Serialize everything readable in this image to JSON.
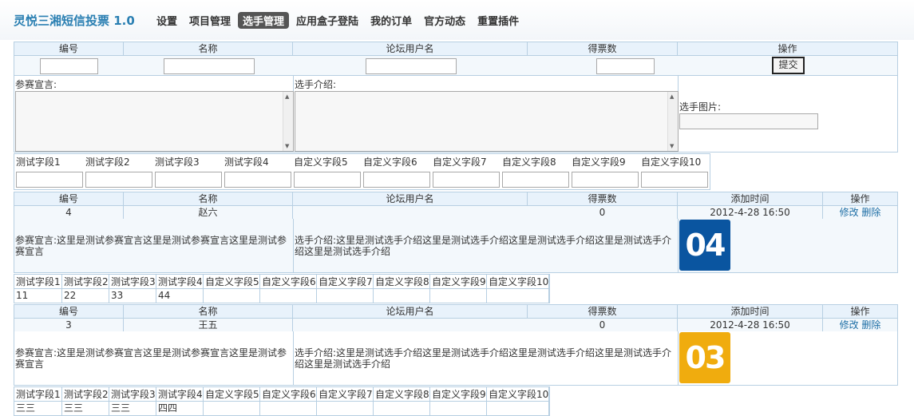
{
  "header": {
    "brand": "灵悦三湘短信投票  1.0",
    "nav": [
      "设置",
      "项目管理",
      "选手管理",
      "应用盒子登陆",
      "我的订单",
      "官方动态",
      "重置插件"
    ],
    "active_nav": "选手管理"
  },
  "form": {
    "columns": [
      "编号",
      "名称",
      "论坛用户名",
      "得票数",
      "操作"
    ],
    "submit_label": "提交",
    "declaration_label": "参赛宣言:",
    "intro_label": "选手介绍:",
    "photo_label": "选手图片:",
    "fields": [
      "测试字段1",
      "测试字段2",
      "测试字段3",
      "测试字段4",
      "自定义字段5",
      "自定义字段6",
      "自定义字段7",
      "自定义字段8",
      "自定义字段9",
      "自定义字段10"
    ]
  },
  "list": {
    "columns": [
      "编号",
      "名称",
      "论坛用户名",
      "得票数",
      "添加时间",
      "操作"
    ],
    "edit_label": "修改",
    "delete_label": "删除",
    "field_headers": [
      "测试字段1",
      "测试字段2",
      "测试字段3",
      "测试字段4",
      "自定义字段5",
      "自定义字段6",
      "自定义字段7",
      "自定义字段8",
      "自定义字段9",
      "自定义字段10"
    ],
    "records": [
      {
        "id": "4",
        "name": "赵六",
        "forum_user": "",
        "votes": "0",
        "added": "2012-4-28 16:50",
        "declaration": "参赛宣言:这里是测试参赛宣言这里是测试参赛宣言这里是测试参赛宣言",
        "intro": "选手介绍:这里是测试选手介绍这里是测试选手介绍这里是测试选手介绍这里是测试选手介绍这里是测试选手介绍",
        "badge": "04",
        "badge_color": "#0a55a0",
        "field_values": [
          "11",
          "22",
          "33",
          "44",
          "",
          "",
          "",
          "",
          "",
          ""
        ]
      },
      {
        "id": "3",
        "name": "王五",
        "forum_user": "",
        "votes": "0",
        "added": "2012-4-28 16:50",
        "declaration": "参赛宣言:这里是测试参赛宣言这里是测试参赛宣言这里是测试参赛宣言",
        "intro": "选手介绍:这里是测试选手介绍这里是测试选手介绍这里是测试选手介绍这里是测试选手介绍这里是测试选手介绍",
        "badge": "03",
        "badge_color": "#f0ac0e",
        "field_values": [
          "三三",
          "三三",
          "三三",
          "四四",
          "",
          "",
          "",
          "",
          "",
          ""
        ]
      }
    ]
  }
}
